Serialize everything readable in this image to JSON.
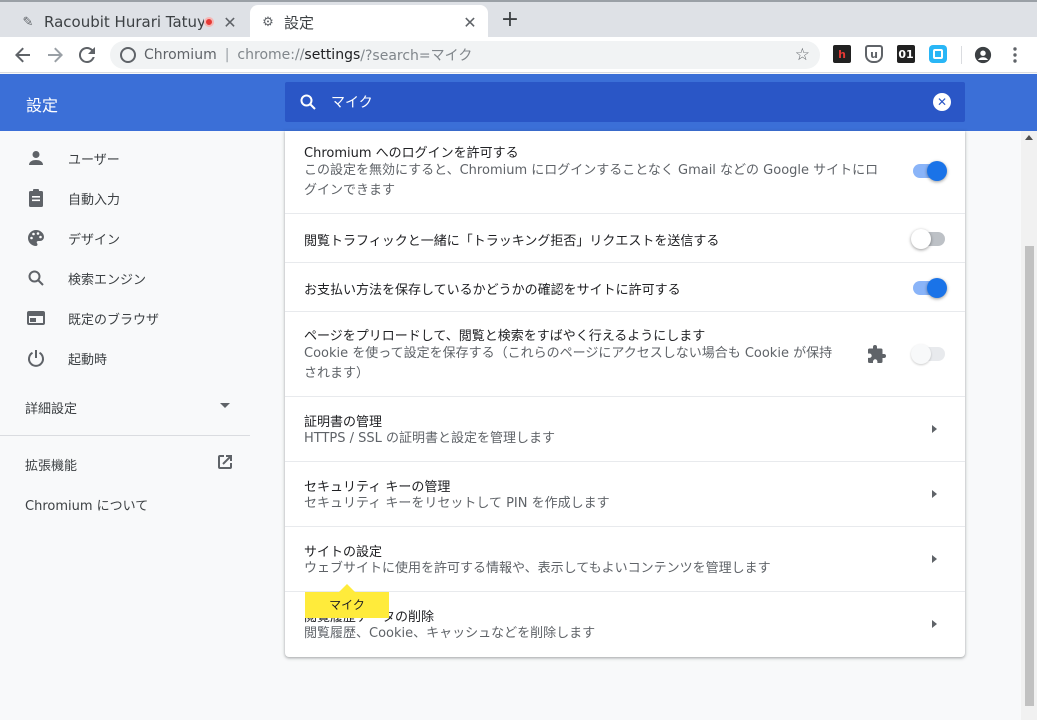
{
  "tabs": [
    {
      "title": "Racoubit Hurari Tatuya",
      "close": "✕"
    },
    {
      "title": "設定",
      "close": "✕"
    }
  ],
  "new_tab": "+",
  "omnibox": {
    "origin": "Chromium",
    "separator": "|",
    "scheme": "chrome://",
    "host": "settings",
    "path": "/?search=マイク"
  },
  "extensions": [
    {
      "name": "h-extension-icon",
      "glyph": "h",
      "color": "#c62828"
    },
    {
      "name": "ublock-icon",
      "glyph": "u",
      "color": "#5f6368"
    },
    {
      "name": "binary-01-icon",
      "glyph": "01",
      "color": "#202124"
    },
    {
      "name": "square-ext-icon",
      "glyph": "",
      "color": "#29b6f6"
    }
  ],
  "header": {
    "title": "設定",
    "search_value": "マイク"
  },
  "sidebar": {
    "items": [
      {
        "label": "ユーザー",
        "icon": "person-icon"
      },
      {
        "label": "自動入力",
        "icon": "clipboard-icon"
      },
      {
        "label": "デザイン",
        "icon": "palette-icon"
      },
      {
        "label": "検索エンジン",
        "icon": "search-icon"
      },
      {
        "label": "既定のブラウザ",
        "icon": "browser-icon"
      },
      {
        "label": "起動時",
        "icon": "power-icon"
      }
    ],
    "advanced": "詳細設定",
    "extensions": "拡張機能",
    "about": "Chromium について"
  },
  "settings": [
    {
      "label": "Chromium へのログインを許可する",
      "sub": "この設定を無効にすると、Chromium にログインすることなく Gmail などの Google サイトにログインできます",
      "control": "toggle-on"
    },
    {
      "label": "閲覧トラフィックと一緒に「トラッキング拒否」リクエストを送信する",
      "sub": "",
      "control": "toggle-off"
    },
    {
      "label": "お支払い方法を保存しているかどうかの確認をサイトに許可する",
      "sub": "",
      "control": "toggle-on"
    },
    {
      "label": "ページをプリロードして、閲覧と検索をすばやく行えるようにします",
      "sub": "Cookie を使って設定を保存する（これらのページにアクセスしない場合も Cookie が保持されます）",
      "control": "toggle-disabled"
    },
    {
      "label": "証明書の管理",
      "sub": "HTTPS / SSL の証明書と設定を管理します",
      "control": "arrow"
    },
    {
      "label": "セキュリティ キーの管理",
      "sub": "セキュリティ キーをリセットして PIN を作成します",
      "control": "arrow"
    },
    {
      "label": "サイトの設定",
      "sub": "ウェブサイトに使用を許可する情報や、表示してもよいコンテンツを管理します",
      "control": "arrow"
    },
    {
      "label": "閲覧履歴データの削除",
      "sub": "閲覧履歴、Cookie、キャッシュなどを削除します",
      "control": "arrow"
    }
  ],
  "highlight": "マイク"
}
